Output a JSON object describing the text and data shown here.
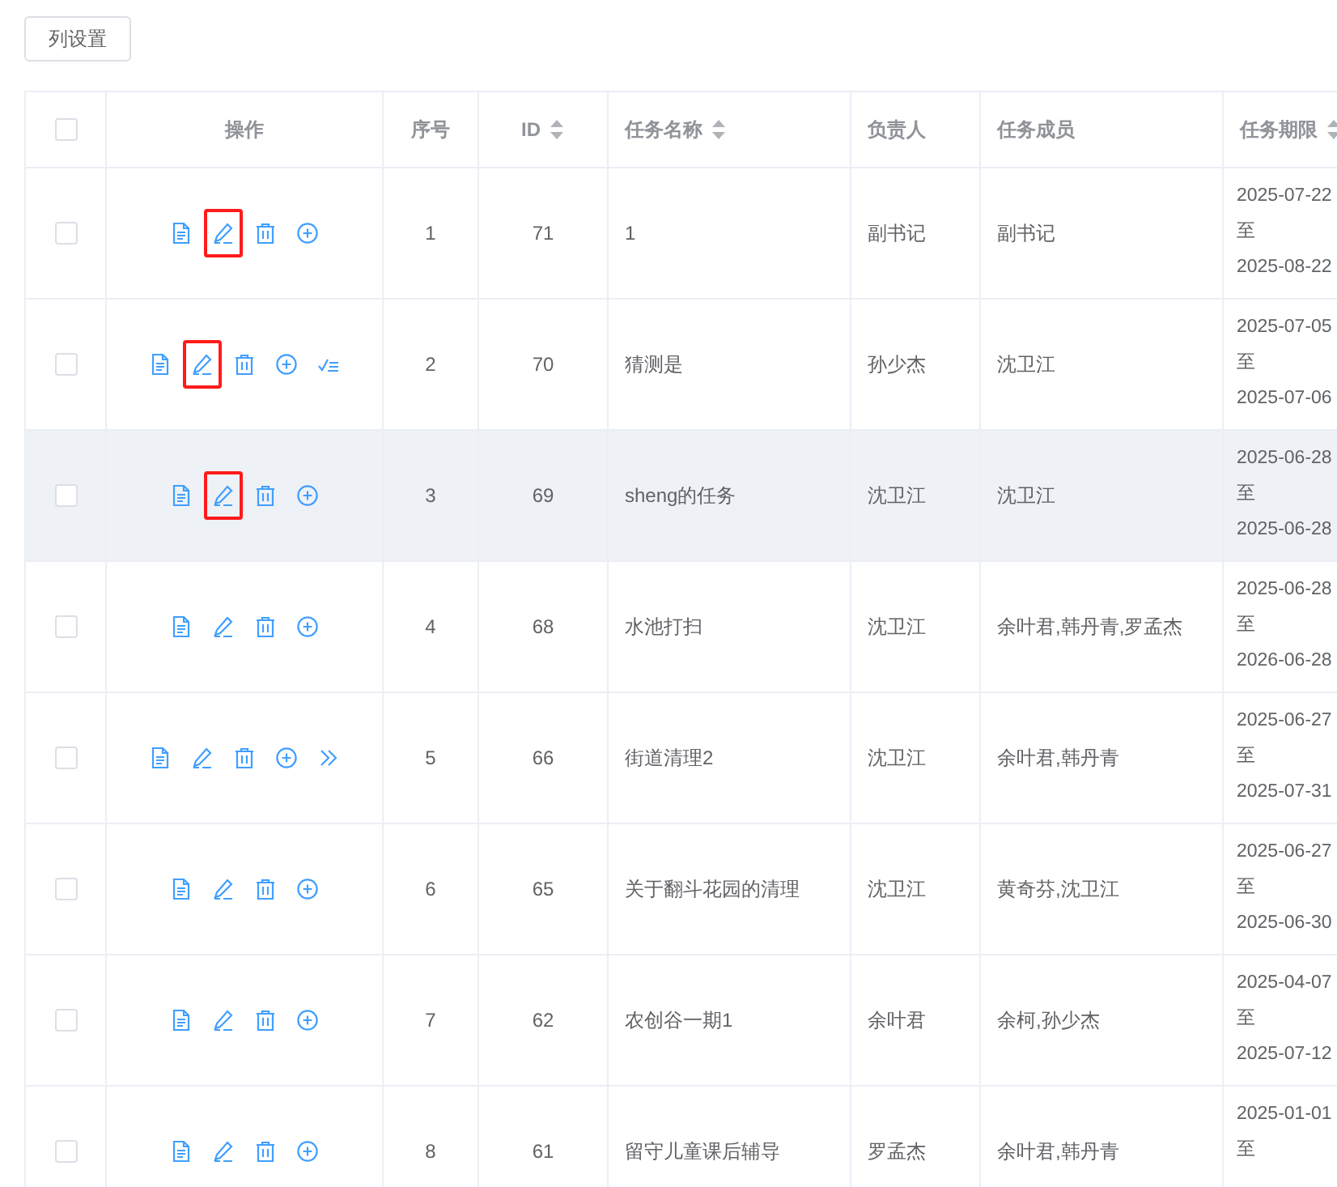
{
  "toolbar": {
    "column_settings_button": "列设置"
  },
  "table": {
    "columns": [
      {
        "kind": "checkbox",
        "checked": false
      },
      {
        "label": "操作",
        "kind": "text",
        "sortable": false
      },
      {
        "label": "序号",
        "kind": "text",
        "sortable": false
      },
      {
        "label": "ID",
        "kind": "text",
        "sortable": true
      },
      {
        "label": "任务名称",
        "kind": "text",
        "sortable": true
      },
      {
        "label": "负责人",
        "kind": "text",
        "sortable": false
      },
      {
        "label": "任务成员",
        "kind": "text",
        "sortable": false
      },
      {
        "label": "任务期限",
        "kind": "text",
        "sortable": true
      }
    ],
    "rows": [
      {
        "checked": false,
        "hovered": false,
        "actions": [
          {
            "kind": "view",
            "highlighted": false
          },
          {
            "kind": "edit",
            "highlighted": true
          },
          {
            "kind": "delete",
            "highlighted": false
          },
          {
            "kind": "add",
            "highlighted": false
          }
        ],
        "index": "1",
        "id": "71",
        "name": "1",
        "owner": "副书记",
        "members": "副书记",
        "period": [
          "2025-07-22",
          "至",
          "2025-08-22"
        ]
      },
      {
        "checked": false,
        "hovered": false,
        "actions": [
          {
            "kind": "view",
            "highlighted": false
          },
          {
            "kind": "edit",
            "highlighted": true
          },
          {
            "kind": "delete",
            "highlighted": false
          },
          {
            "kind": "add",
            "highlighted": false
          },
          {
            "kind": "review",
            "highlighted": false
          }
        ],
        "index": "2",
        "id": "70",
        "name": "猜测是",
        "owner": "孙少杰",
        "members": "沈卫江",
        "period": [
          "2025-07-05",
          "至",
          "2025-07-06"
        ]
      },
      {
        "checked": false,
        "hovered": true,
        "actions": [
          {
            "kind": "view",
            "highlighted": false
          },
          {
            "kind": "edit",
            "highlighted": true
          },
          {
            "kind": "delete",
            "highlighted": false
          },
          {
            "kind": "add",
            "highlighted": false
          }
        ],
        "index": "3",
        "id": "69",
        "name": "sheng的任务",
        "owner": "沈卫江",
        "members": "沈卫江",
        "period": [
          "2025-06-28",
          "至",
          "2025-06-28"
        ]
      },
      {
        "checked": false,
        "hovered": false,
        "actions": [
          {
            "kind": "view",
            "highlighted": false
          },
          {
            "kind": "edit",
            "highlighted": false
          },
          {
            "kind": "delete",
            "highlighted": false
          },
          {
            "kind": "add",
            "highlighted": false
          }
        ],
        "index": "4",
        "id": "68",
        "name": "水池打扫",
        "owner": "沈卫江",
        "members": "余叶君,韩丹青,罗孟杰",
        "period": [
          "2025-06-28",
          "至",
          "2026-06-28"
        ]
      },
      {
        "checked": false,
        "hovered": false,
        "actions": [
          {
            "kind": "view",
            "highlighted": false
          },
          {
            "kind": "edit",
            "highlighted": false
          },
          {
            "kind": "delete",
            "highlighted": false
          },
          {
            "kind": "add",
            "highlighted": false
          },
          {
            "kind": "forward",
            "highlighted": false
          }
        ],
        "index": "5",
        "id": "66",
        "name": "街道清理2",
        "owner": "沈卫江",
        "members": "余叶君,韩丹青",
        "period": [
          "2025-06-27",
          "至",
          "2025-07-31"
        ]
      },
      {
        "checked": false,
        "hovered": false,
        "actions": [
          {
            "kind": "view",
            "highlighted": false
          },
          {
            "kind": "edit",
            "highlighted": false
          },
          {
            "kind": "delete",
            "highlighted": false
          },
          {
            "kind": "add",
            "highlighted": false
          }
        ],
        "index": "6",
        "id": "65",
        "name": "关于翻斗花园的清理",
        "owner": "沈卫江",
        "members": "黄奇芬,沈卫江",
        "period": [
          "2025-06-27",
          "至",
          "2025-06-30"
        ]
      },
      {
        "checked": false,
        "hovered": false,
        "actions": [
          {
            "kind": "view",
            "highlighted": false
          },
          {
            "kind": "edit",
            "highlighted": false
          },
          {
            "kind": "delete",
            "highlighted": false
          },
          {
            "kind": "add",
            "highlighted": false
          }
        ],
        "index": "7",
        "id": "62",
        "name": "农创谷一期1",
        "owner": "余叶君",
        "members": "余柯,孙少杰",
        "period": [
          "2025-04-07",
          "至",
          "2025-07-12"
        ]
      },
      {
        "checked": false,
        "hovered": false,
        "actions": [
          {
            "kind": "view",
            "highlighted": false
          },
          {
            "kind": "edit",
            "highlighted": false
          },
          {
            "kind": "delete",
            "highlighted": false
          },
          {
            "kind": "add",
            "highlighted": false
          }
        ],
        "index": "8",
        "id": "61",
        "name": "留守儿童课后辅导",
        "owner": "罗孟杰",
        "members": "余叶君,韩丹青",
        "period": [
          "2025-01-01",
          "至"
        ]
      }
    ]
  }
}
